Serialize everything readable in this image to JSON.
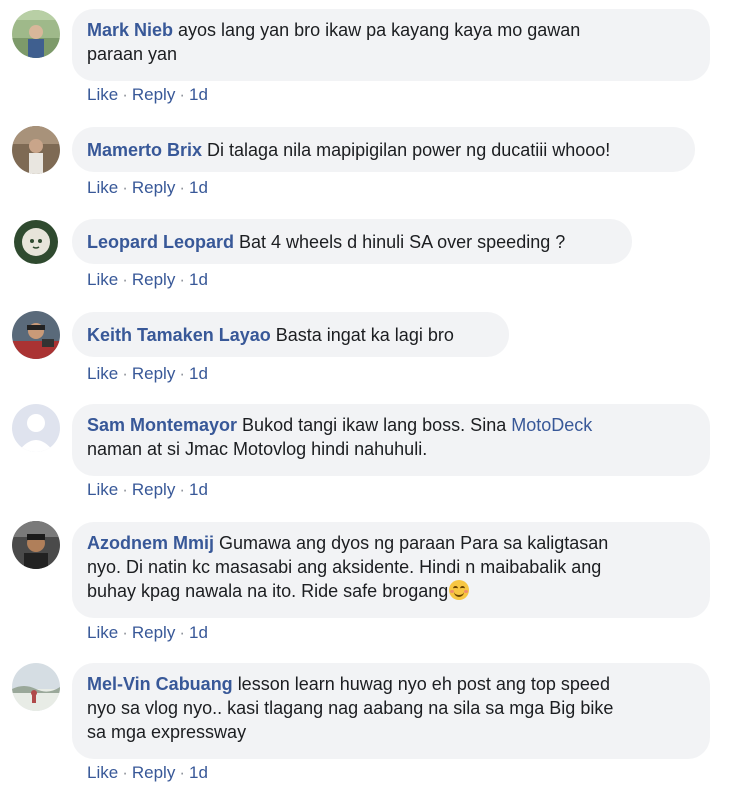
{
  "comments": [
    {
      "author": "Mark Nieb",
      "text_1": "ayos lang yan bro ikaw pa kayang kaya mo gawan",
      "text_2": "paraan yan",
      "like": "Like",
      "reply": "Reply",
      "time": "1d"
    },
    {
      "author": "Mamerto Brix",
      "text_1": "Di talaga nila mapipigilan power ng ducatiii whooo!",
      "like": "Like",
      "reply": "Reply",
      "time": "1d"
    },
    {
      "author": "Leopard Leopard",
      "text_1": "Bat 4 wheels d hinuli SA over speeding ?",
      "like": "Like",
      "reply": "Reply",
      "time": "1d"
    },
    {
      "author": "Keith Tamaken Layao",
      "text_1": "Basta ingat ka lagi bro",
      "like": "Like",
      "reply": "Reply",
      "time": "1d"
    },
    {
      "author": "Sam Montemayor",
      "text_1a": "Bukod tangi ikaw lang boss. Sina",
      "mention": "MotoDeck",
      "text_2": "naman at si Jmac Motovlog hindi nahuhuli.",
      "like": "Like",
      "reply": "Reply",
      "time": "1d"
    },
    {
      "author": "Azodnem Mmij",
      "text_1": "Gumawa ang dyos ng paraan Para sa kaligtasan",
      "text_2": "nyo. Di natin kc masasabi ang aksidente. Hindi n maibabalik ang",
      "text_3": "buhay kpag nawala na ito. Ride safe brogang",
      "emoji": "smiling-face-emoji",
      "like": "Like",
      "reply": "Reply",
      "time": "1d"
    },
    {
      "author": "Mel-Vin Cabuang",
      "text_1": "lesson learn huwag nyo eh post ang top speed",
      "text_2": "nyo sa vlog nyo.. kasi tlagang nag aabang na sila sa mga Big bike",
      "text_3": "sa mga expressway",
      "like": "Like",
      "reply": "Reply",
      "time": "1d"
    }
  ],
  "separator": "·",
  "colors": {
    "author": "#385898",
    "bubble": "#f2f3f5",
    "text": "#1c1e21",
    "meta": "#90949c"
  }
}
